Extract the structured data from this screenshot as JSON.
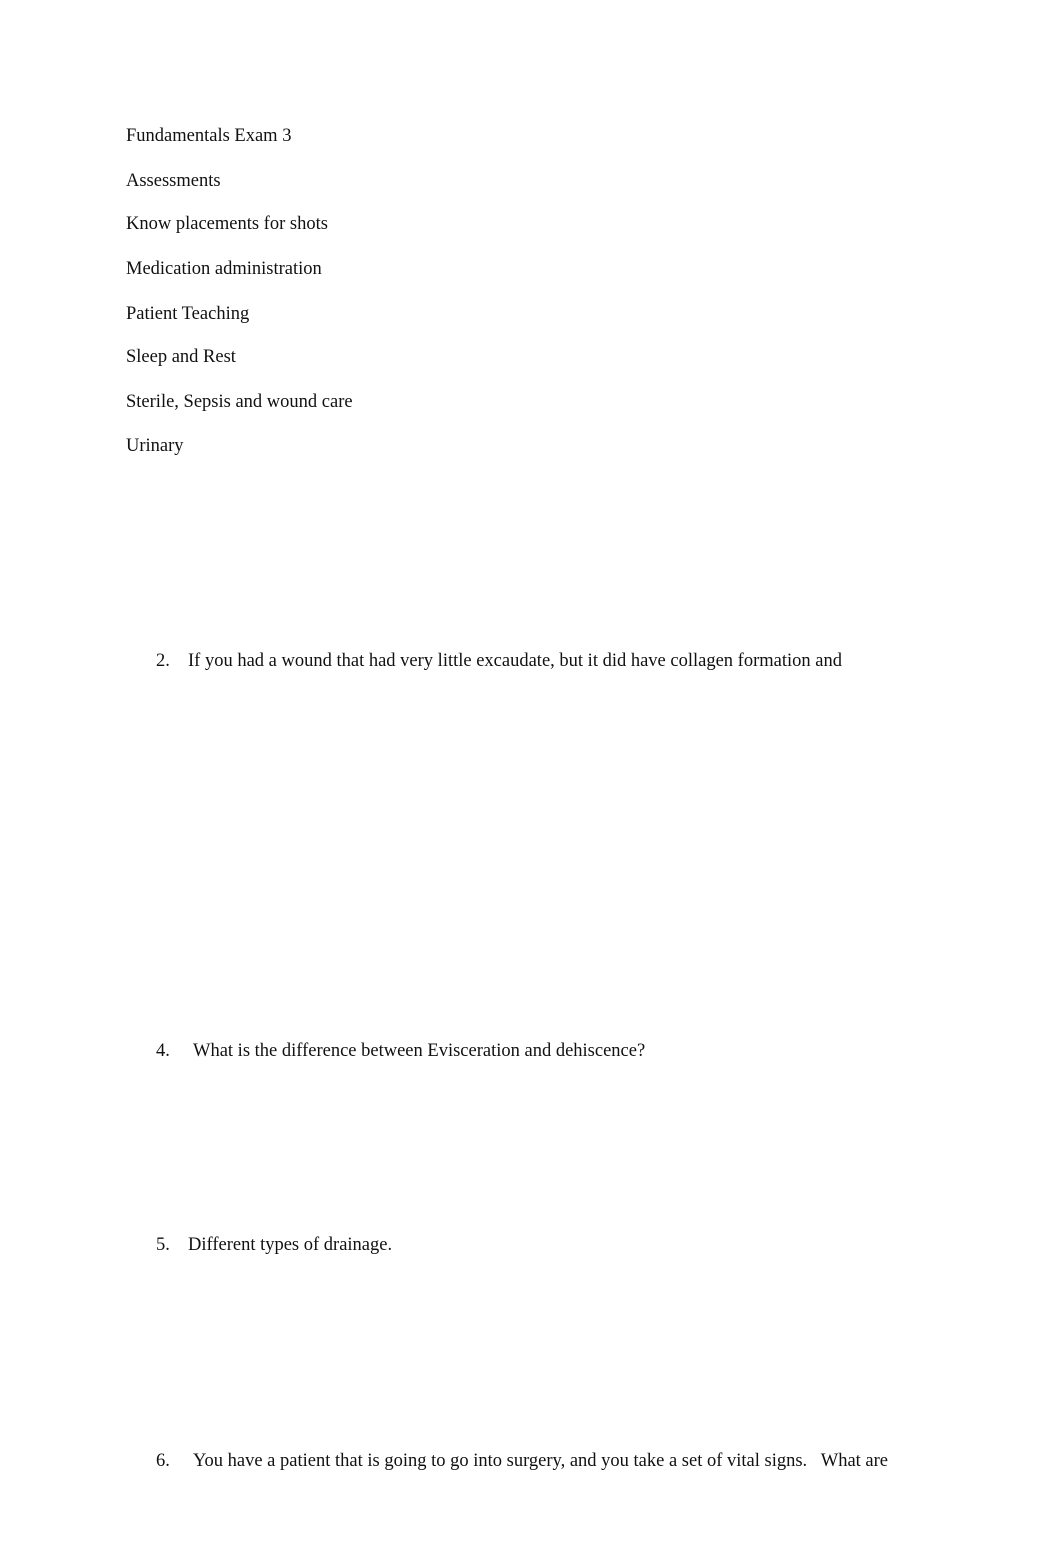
{
  "document": {
    "title": "Fundamentals Exam 3",
    "topics": [
      "Assessments",
      "Know placements for shots",
      "Medication administration",
      "Patient Teaching",
      "Sleep and Rest",
      "Sterile, Sepsis and wound care",
      "Urinary"
    ],
    "questions": [
      {
        "number": "2.",
        "text": "If you had a wound that had very little excaudate, but it did have collagen formation and"
      },
      {
        "number": "4.",
        "text": "What is the difference between Evisceration and dehiscence?"
      },
      {
        "number": "5.",
        "text": "Different types of drainage."
      },
      {
        "number": "6.",
        "text": "You have a patient that is going to go into surgery, and you take a set of vital signs.   What are"
      }
    ]
  }
}
